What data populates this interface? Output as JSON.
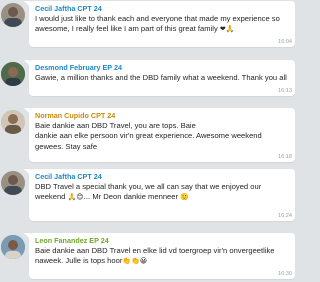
{
  "messages": [
    {
      "sender": "Cecil Jaftha CPT 24",
      "sender_color": "#1f88c7",
      "text": "I would just like to thank each and everyone that made my experience so awesome, I really feel like I am part of this great family",
      "emoji": "❤🙏",
      "time": "16:04"
    },
    {
      "sender": "Desmond February EP 24",
      "sender_color": "#1f88c7",
      "text": "Gawie, a million thanks and the DBD family what a weekend. Thank you all",
      "emoji": "",
      "time": "16:13"
    },
    {
      "sender": "Norman Cupido CPT 24",
      "sender_color": "#c98c0c",
      "text": "Baie dankie aan DBD  Travel, you are tops. Baie\ndankie aan elke persoon vir'n great experience. Awesome weekend  gewees. Stay safe",
      "emoji": "",
      "time": "16:18"
    },
    {
      "sender": "Cecil Jaftha CPT 24",
      "sender_color": "#1f88c7",
      "text": "DBD Travel a special thank you, we all can say that we enjoyed our weekend",
      "emoji": "🙏😊...",
      "text2": " Mr Deon dankie menneer",
      "emoji2": "🙂",
      "time": "16:24"
    },
    {
      "sender": "Leon Fanandez EP 24",
      "sender_color": "#6fa82c",
      "text": "Baie dankie aan DBD Travel en elke lid vd toergroep vir'n onvergeetlike naweek. Julle is tops hoor",
      "emoji": "👏👏😀",
      "time": "16:30"
    }
  ],
  "colors": {
    "background": "#dfe3e6",
    "bubble": "#ffffff",
    "time": "#9aa1a6"
  }
}
